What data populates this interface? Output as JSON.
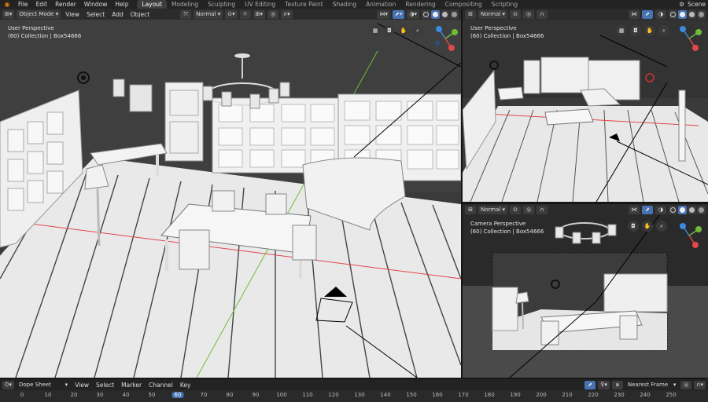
{
  "topbar": {
    "menus": [
      "File",
      "Edit",
      "Render",
      "Window",
      "Help"
    ],
    "workspaces": [
      "Layout",
      "Modeling",
      "Sculpting",
      "UV Editing",
      "Texture Paint",
      "Shading",
      "Animation",
      "Rendering",
      "Compositing",
      "Scripting"
    ],
    "active_workspace": "Layout",
    "scene_label": "Scene"
  },
  "viewport_main": {
    "mode": "Object Mode",
    "menus": [
      "View",
      "Select",
      "Add",
      "Object"
    ],
    "orientation": "Normal",
    "perspective_label": "User Perspective",
    "collection_label": "(60) Collection | Box54666"
  },
  "viewport_top_right": {
    "orientation": "Normal",
    "perspective_label": "User Perspective",
    "collection_label": "(60) Collection | Box54666"
  },
  "viewport_bottom_right": {
    "orientation": "Normal",
    "perspective_label": "Camera Perspective",
    "collection_label": "(60) Collection | Box54666"
  },
  "timeline": {
    "editor": "Dope Sheet",
    "menus": [
      "View",
      "Select",
      "Marker",
      "Channel",
      "Key"
    ],
    "interpolation": "Nearest Frame",
    "current_frame": 60,
    "frames": [
      0,
      10,
      20,
      30,
      40,
      50,
      60,
      70,
      80,
      90,
      100,
      110,
      120,
      130,
      140,
      150,
      160,
      170,
      180,
      190,
      200,
      210,
      220,
      230,
      240,
      250
    ]
  },
  "colors": {
    "accent": "#4772b3",
    "axis_x": "#e2474b",
    "axis_y": "#6fbb3a",
    "axis_z": "#3b8ae0",
    "logo": "#e87d0d"
  },
  "icons": {
    "logo": "blender-logo-icon",
    "camera": "camera-icon",
    "hand": "hand-pan-icon",
    "zoom": "zoom-icon",
    "grid": "grid-icon",
    "light": "light-icon"
  }
}
